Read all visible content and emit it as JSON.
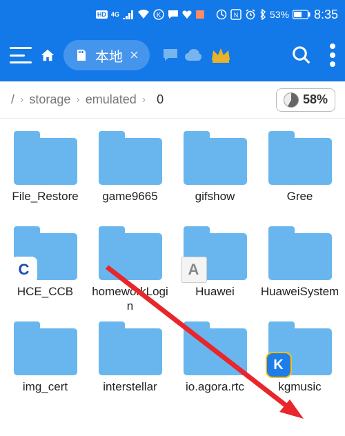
{
  "status": {
    "hd": "HD",
    "net": "4G",
    "battery_pct": "53%",
    "time": "8:35"
  },
  "appbar": {
    "location_label": "本地"
  },
  "breadcrumb": {
    "root": "/",
    "p1": "storage",
    "p2": "emulated",
    "p3": "0"
  },
  "storage": {
    "used_pct": "58%"
  },
  "folders": [
    {
      "name": "File_Restore",
      "overlay": null
    },
    {
      "name": "game9665",
      "overlay": null
    },
    {
      "name": "gifshow",
      "overlay": null
    },
    {
      "name": "Gree",
      "overlay": null
    },
    {
      "name": "HCE_CCB",
      "overlay": "ccb"
    },
    {
      "name": "homeworkLogin",
      "overlay": null
    },
    {
      "name": "Huawei",
      "overlay": "a"
    },
    {
      "name": "HuaweiSystem",
      "overlay": null
    },
    {
      "name": "img_cert",
      "overlay": null
    },
    {
      "name": "interstellar",
      "overlay": null
    },
    {
      "name": "io.agora.rtc",
      "overlay": null
    },
    {
      "name": "kgmusic",
      "overlay": "k"
    }
  ],
  "overlays": {
    "ccb": "C",
    "a": "A",
    "k": "K"
  }
}
